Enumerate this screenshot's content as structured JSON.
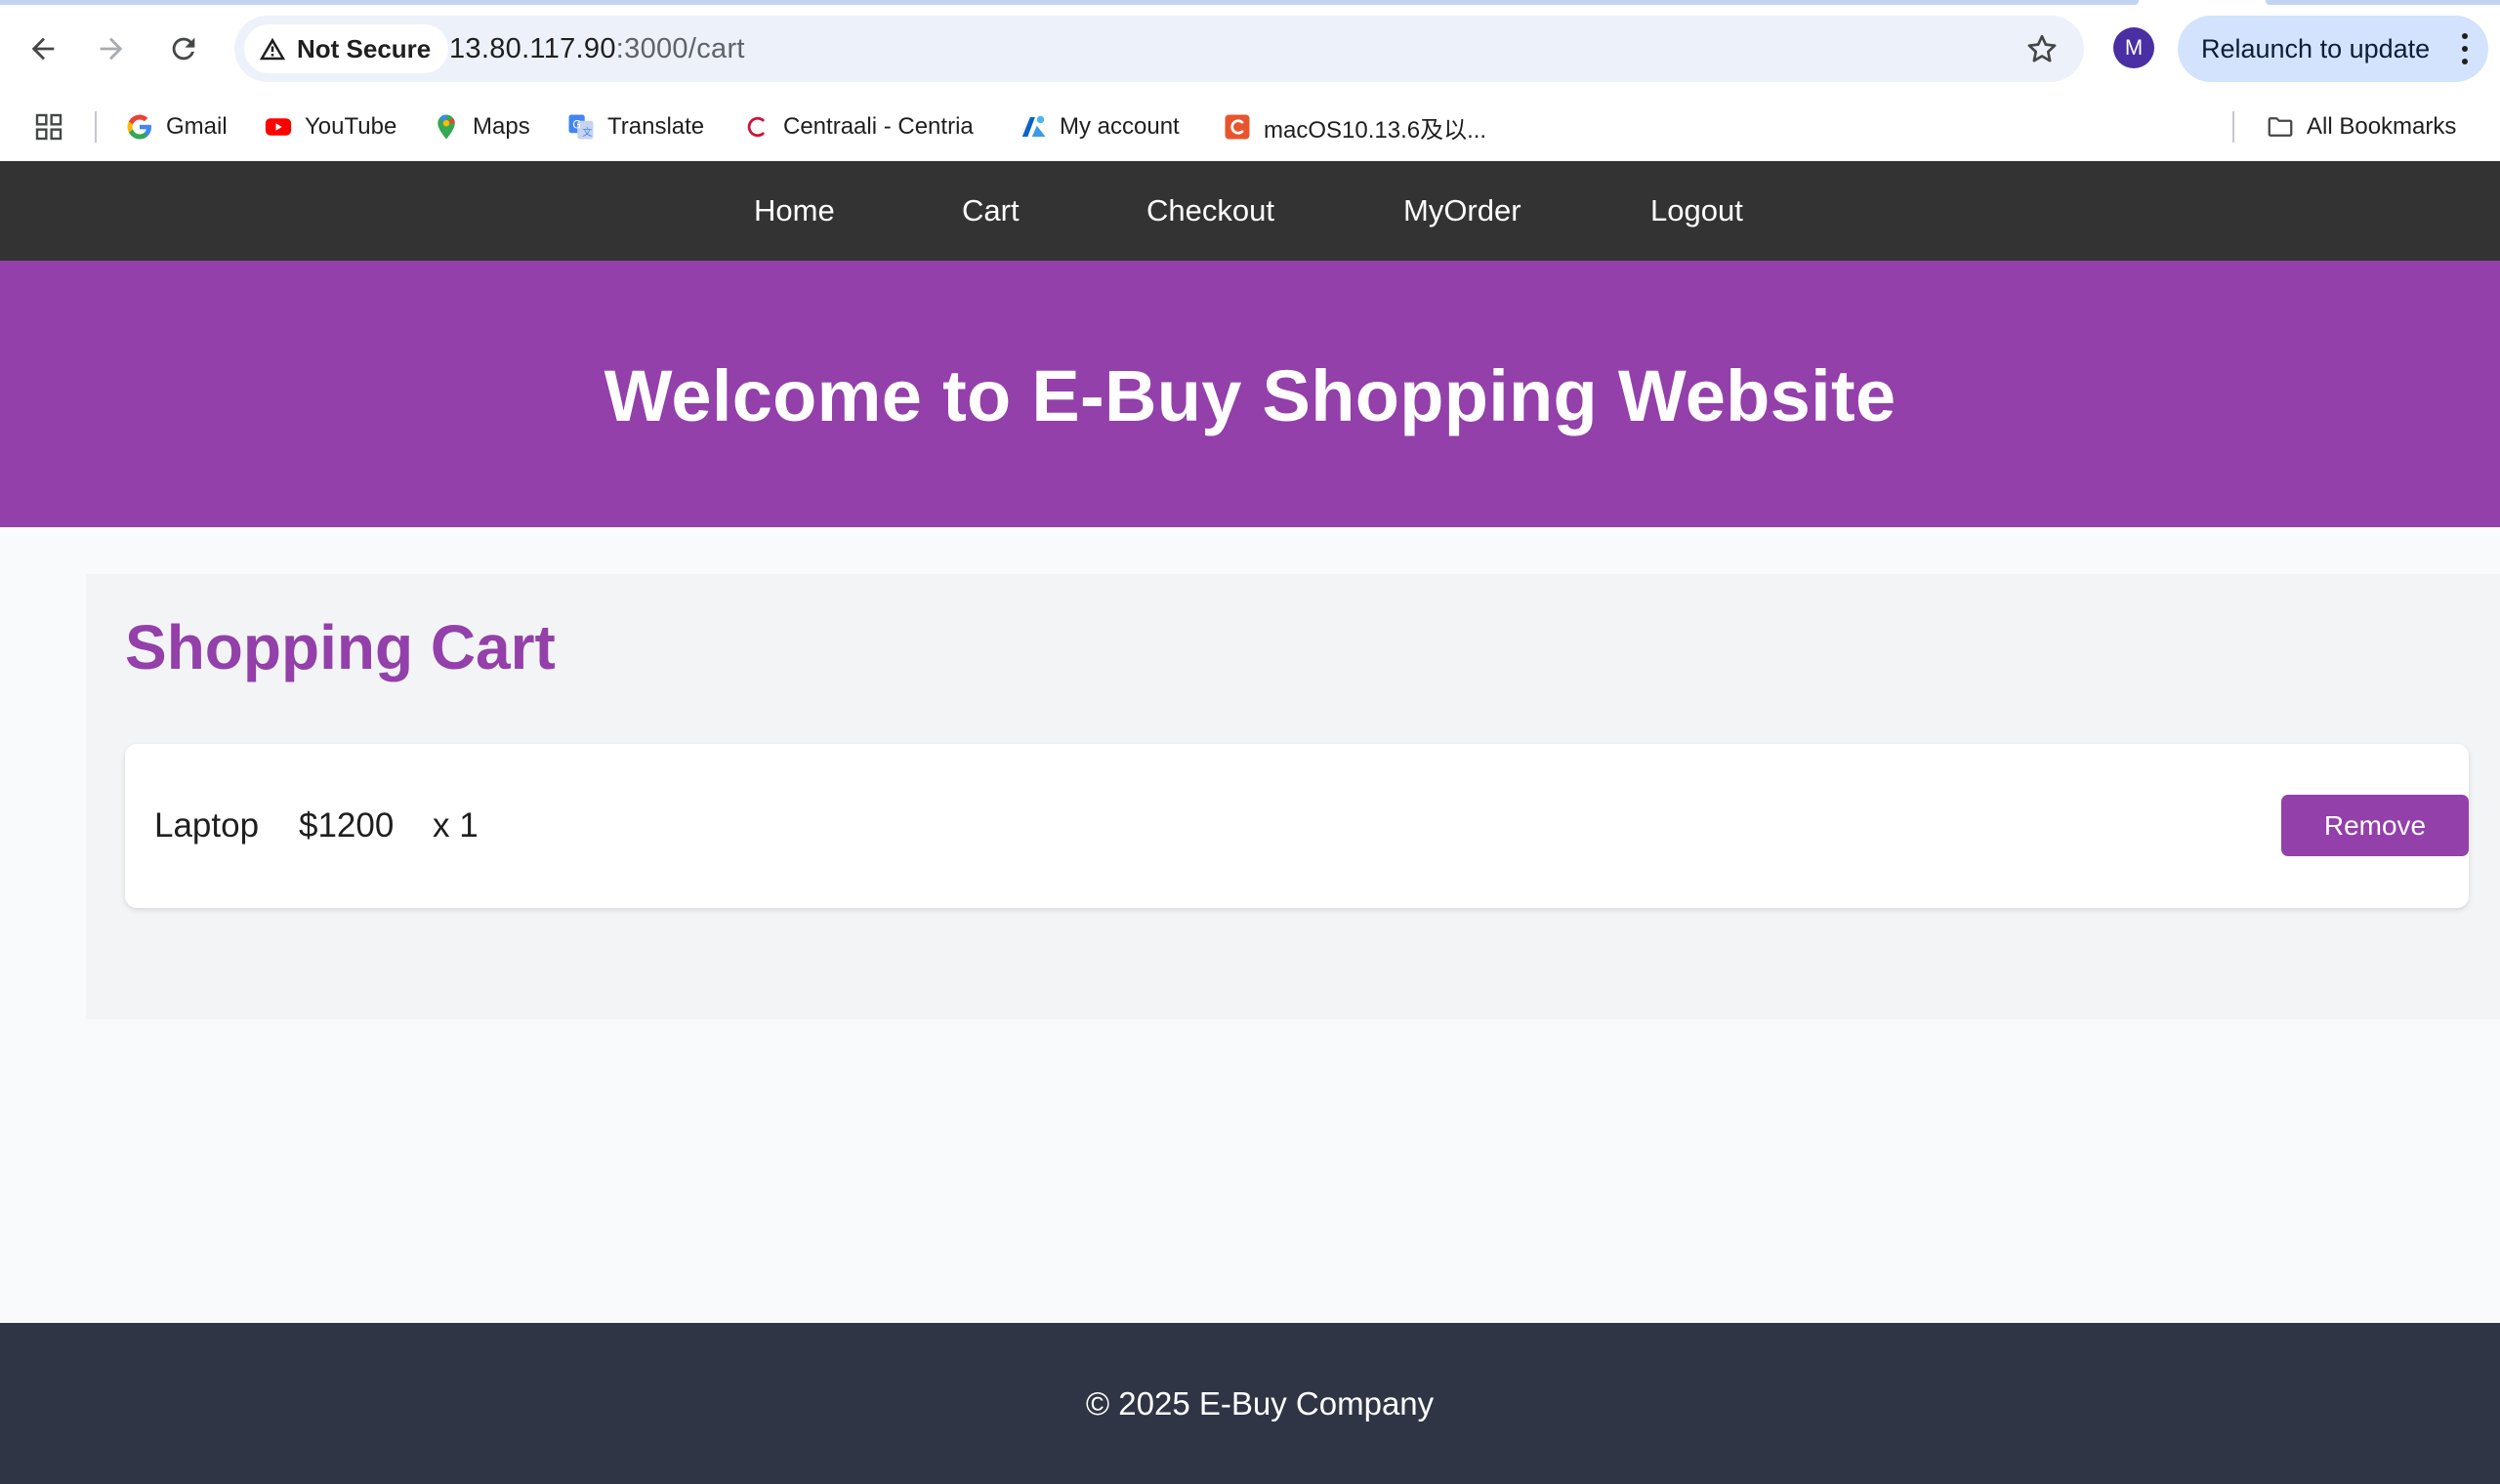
{
  "browser": {
    "security_label": "Not Secure",
    "url_host": "13.80.117.90",
    "url_path": ":3000/cart",
    "profile_initial": "M",
    "relaunch_label": "Relaunch to update",
    "bookmarks": [
      {
        "label": "Gmail",
        "icon": "google-g-icon"
      },
      {
        "label": "YouTube",
        "icon": "youtube-icon"
      },
      {
        "label": "Maps",
        "icon": "maps-pin-icon"
      },
      {
        "label": "Translate",
        "icon": "translate-icon"
      },
      {
        "label": "Centraali - Centria",
        "icon": "centria-c-icon"
      },
      {
        "label": "My account",
        "icon": "azure-account-icon"
      },
      {
        "label": "macOS10.13.6及以...",
        "icon": "c-site-icon"
      }
    ],
    "all_bookmarks_label": "All Bookmarks"
  },
  "site_nav": {
    "items": [
      "Home",
      "Cart",
      "Checkout",
      "MyOrder",
      "Logout"
    ]
  },
  "banner": {
    "title": "Welcome to E-Buy Shopping Website"
  },
  "cart": {
    "title": "Shopping Cart",
    "items": [
      {
        "name": "Laptop",
        "price": "$1200",
        "quantity": "x 1",
        "remove_label": "Remove"
      }
    ]
  },
  "footer": {
    "text": "© 2025 E-Buy Company"
  },
  "colors": {
    "nav_bg": "#333333",
    "accent_purple": "#9340aa",
    "footer_bg": "#2f3545"
  }
}
